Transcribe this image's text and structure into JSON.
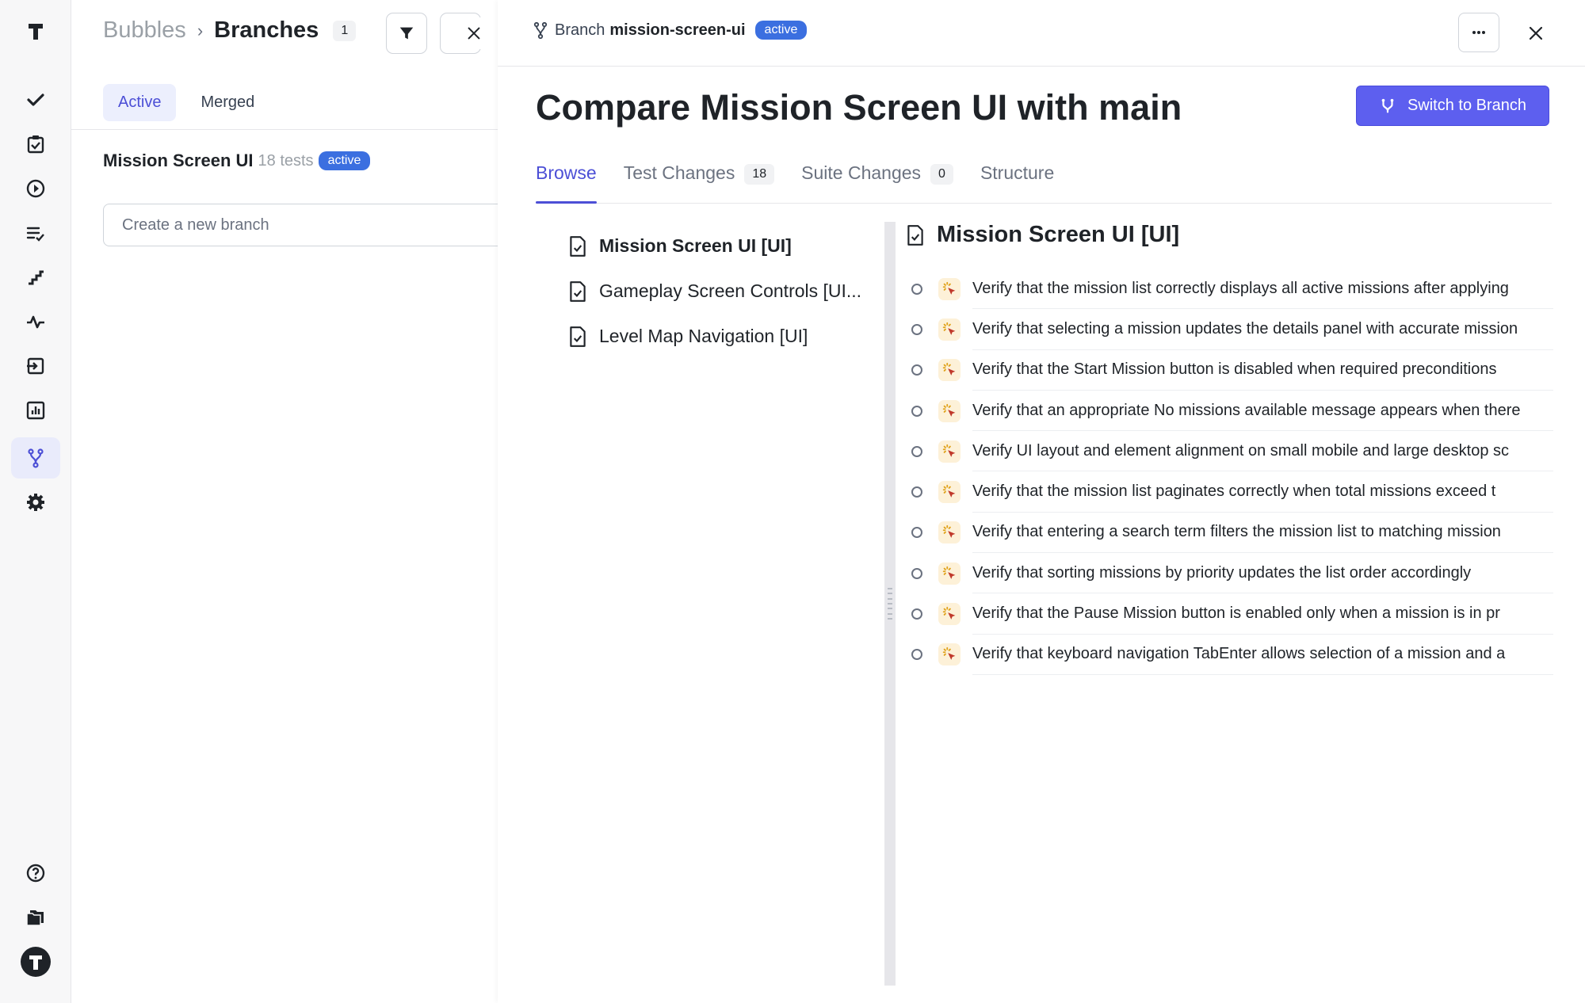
{
  "rail": {
    "items": [
      {
        "name": "logo-icon"
      },
      {
        "name": "checkmark-icon"
      },
      {
        "name": "clipboard-check-icon"
      },
      {
        "name": "play-circle-icon"
      },
      {
        "name": "checklist-icon"
      },
      {
        "name": "steps-icon"
      },
      {
        "name": "activity-icon"
      },
      {
        "name": "import-icon"
      },
      {
        "name": "bar-chart-icon"
      },
      {
        "name": "branch-icon",
        "active": true
      },
      {
        "name": "settings-icon"
      },
      {
        "name": "help-icon"
      },
      {
        "name": "folders-icon"
      },
      {
        "name": "account-avatar-icon"
      }
    ]
  },
  "background": {
    "breadcrumb": {
      "parent": "Bubbles",
      "separator": "›",
      "current": "Branches",
      "count": "1"
    },
    "tabs": [
      {
        "label": "Active",
        "active": true
      },
      {
        "label": "Merged",
        "active": false
      }
    ],
    "branch": {
      "name": "Mission Screen UI",
      "tests": "18 tests",
      "status": "active"
    },
    "new_branch_placeholder": "Create a new branch"
  },
  "panel": {
    "header": {
      "label": "Branch",
      "branch": "mission-screen-ui",
      "status": "active"
    },
    "title": "Compare Mission Screen UI with main",
    "switch_button": "Switch to Branch",
    "tabs": [
      {
        "label": "Browse",
        "count": null,
        "active": true
      },
      {
        "label": "Test Changes",
        "count": "18",
        "active": false
      },
      {
        "label": "Suite Changes",
        "count": "0",
        "active": false
      },
      {
        "label": "Structure",
        "count": null,
        "active": false
      }
    ],
    "tree": [
      {
        "label": "Mission Screen UI [UI]",
        "selected": true
      },
      {
        "label": "Gameplay Screen Controls [UI...",
        "selected": false
      },
      {
        "label": "Level Map Navigation [UI]",
        "selected": false
      }
    ],
    "suite_title": "Mission Screen UI [UI]",
    "tests": [
      "Verify that the mission list correctly displays all active missions after applying",
      "Verify that selecting a mission updates the details panel with accurate mission",
      "Verify that the Start Mission button is disabled when required preconditions",
      "Verify that an appropriate No missions available message appears when there",
      "Verify UI layout and element alignment on small mobile and large desktop sc",
      "Verify that the mission list paginates correctly when total missions exceed t",
      "Verify that entering a search term filters the mission list to matching mission",
      "Verify that sorting missions by priority updates the list order accordingly",
      "Verify that the Pause Mission button is enabled only when a mission is in pr",
      "Verify that keyboard navigation TabEnter allows selection of a mission and a"
    ]
  },
  "colors": {
    "accent": "#5d5fef",
    "active_pill": "#3b6fe0",
    "tab_active": "#4c4fd6"
  }
}
